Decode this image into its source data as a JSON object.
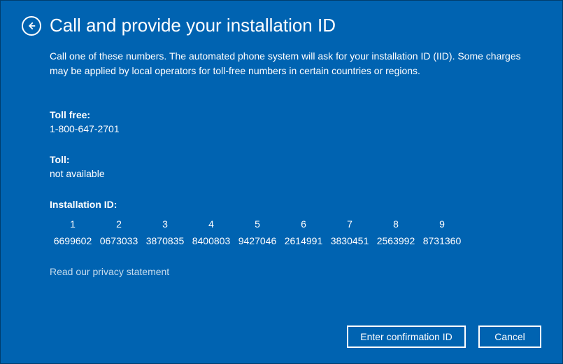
{
  "header": {
    "title": "Call and provide your installation ID"
  },
  "intro": "Call one of these numbers. The automated phone system will ask for your installation ID (IID). Some charges may be applied by local operators for toll-free numbers in certain countries or regions.",
  "toll_free": {
    "label": "Toll free:",
    "value": "1-800-647-2701"
  },
  "toll": {
    "label": "Toll:",
    "value": "not available"
  },
  "installation_id": {
    "label": "Installation ID:",
    "columns": [
      {
        "index": "1",
        "value": "6699602"
      },
      {
        "index": "2",
        "value": "0673033"
      },
      {
        "index": "3",
        "value": "3870835"
      },
      {
        "index": "4",
        "value": "8400803"
      },
      {
        "index": "5",
        "value": "9427046"
      },
      {
        "index": "6",
        "value": "2614991"
      },
      {
        "index": "7",
        "value": "3830451"
      },
      {
        "index": "8",
        "value": "2563992"
      },
      {
        "index": "9",
        "value": "8731360"
      }
    ]
  },
  "privacy_link": "Read our privacy statement",
  "buttons": {
    "primary": "Enter confirmation ID",
    "cancel": "Cancel"
  }
}
